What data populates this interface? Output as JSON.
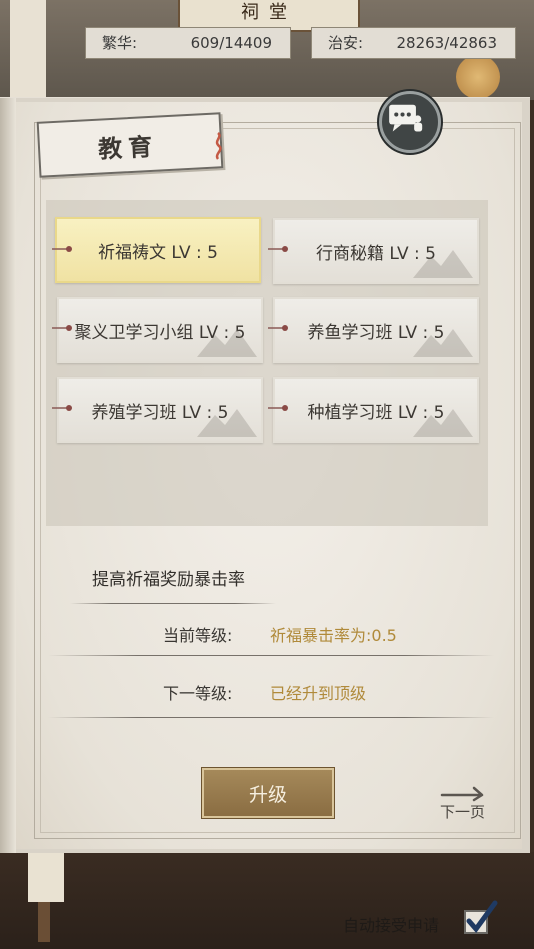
{
  "header": {
    "title_plaque": "祠堂",
    "prosperity": {
      "label": "繁华:",
      "value": "609/14409"
    },
    "security": {
      "label": "治安:",
      "value": "28263/42863"
    }
  },
  "panel": {
    "title": "教育",
    "chat_icon": "chat-bubble-icon",
    "skills": [
      {
        "name": "祈福祷文 LV : 5",
        "selected": true
      },
      {
        "name": "行商秘籍 LV : 5",
        "selected": false
      },
      {
        "name": "聚义卫学习小组 LV : 5",
        "selected": false
      },
      {
        "name": "养鱼学习班 LV : 5",
        "selected": false
      },
      {
        "name": "养殖学习班 LV : 5",
        "selected": false
      },
      {
        "name": "种植学习班 LV : 5",
        "selected": false
      }
    ],
    "description": "提高祈福奖励暴击率",
    "current_level": {
      "label": "当前等级:",
      "value": "祈福暴击率为:0.5"
    },
    "next_level": {
      "label": "下一等级:",
      "value": "已经升到顶级"
    },
    "upgrade_label": "升级",
    "next_page_label": "下一页"
  },
  "footer": {
    "auto_accept_label": "自动接受申请",
    "auto_accept_checked": true
  },
  "colors": {
    "selected_skill": "#f4e9b2",
    "value_text": "#b08a3a",
    "upgrade_button": "#9a7c4e"
  }
}
